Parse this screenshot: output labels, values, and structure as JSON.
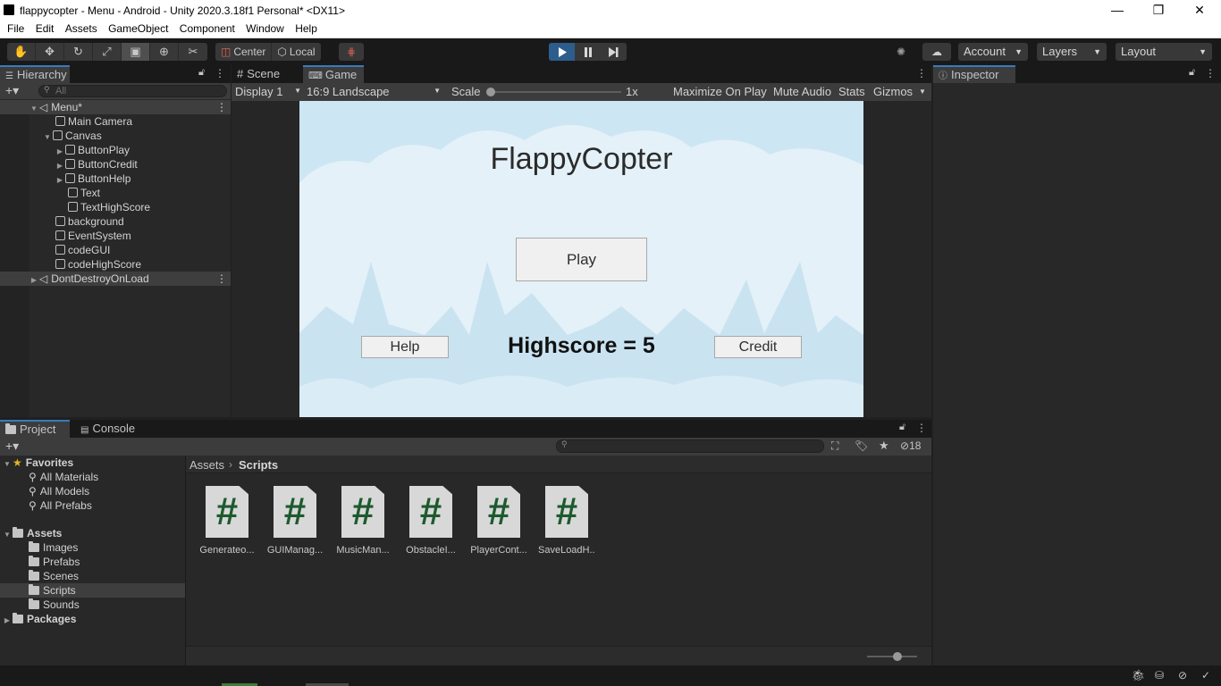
{
  "window": {
    "title": "flappycopter - Menu - Android - Unity 2020.3.18f1 Personal* <DX11>",
    "minimize": "—",
    "maximize": "❐",
    "close": "✕"
  },
  "menu": [
    "File",
    "Edit",
    "Assets",
    "GameObject",
    "Component",
    "Window",
    "Help"
  ],
  "toolbar": {
    "pivot_label": "Center",
    "space_label": "Local",
    "account_label": "Account",
    "layers_label": "Layers",
    "layout_label": "Layout"
  },
  "hierarchy": {
    "tab_label": "Hierarchy",
    "search_placeholder": "All",
    "items": [
      {
        "label": "Menu*"
      },
      {
        "label": "Main Camera"
      },
      {
        "label": "Canvas"
      },
      {
        "label": "ButtonPlay"
      },
      {
        "label": "ButtonCredit"
      },
      {
        "label": "ButtonHelp"
      },
      {
        "label": "Text"
      },
      {
        "label": "TextHighScore"
      },
      {
        "label": "background"
      },
      {
        "label": "EventSystem"
      },
      {
        "label": "codeGUI"
      },
      {
        "label": "codeHighScore"
      },
      {
        "label": "DontDestroyOnLoad"
      }
    ]
  },
  "scene_tabs": {
    "scene_label": "Scene",
    "game_label": "Game"
  },
  "game_toolbar": {
    "display": "Display 1",
    "aspect": "16:9 Landscape",
    "scale_label": "Scale",
    "scale_value": "1x",
    "scale_level": 0,
    "maximize": "Maximize On Play",
    "mute": "Mute Audio",
    "stats": "Stats",
    "gizmos": "Gizmos"
  },
  "game_view": {
    "title": "FlappyCopter",
    "play_label": "Play",
    "help_label": "Help",
    "credit_label": "Credit",
    "highscore": "Highscore = 5",
    "sky_color": "#cde6f3"
  },
  "inspector": {
    "tab_label": "Inspector"
  },
  "bottom_tabs": {
    "project_label": "Project",
    "console_label": "Console"
  },
  "project": {
    "hidden_count": "18",
    "favorites_label": "Favorites",
    "favorites": [
      "All Materials",
      "All Models",
      "All Prefabs"
    ],
    "assets_label": "Assets",
    "asset_folders": [
      "Images",
      "Prefabs",
      "Scenes",
      "Scripts",
      "Sounds"
    ],
    "packages_label": "Packages",
    "breadcrumb_root": "Assets",
    "breadcrumb_current": "Scripts",
    "scripts": [
      "Generateo...",
      "GUIManag...",
      "MusicMan...",
      "ObstacleI...",
      "PlayerCont...",
      "SaveLoadH..."
    ],
    "script_glyph": "#"
  },
  "colors": {
    "accent": "#3a79bb",
    "play_active": "#2d5d8c",
    "selection": "#3e3e3e"
  }
}
